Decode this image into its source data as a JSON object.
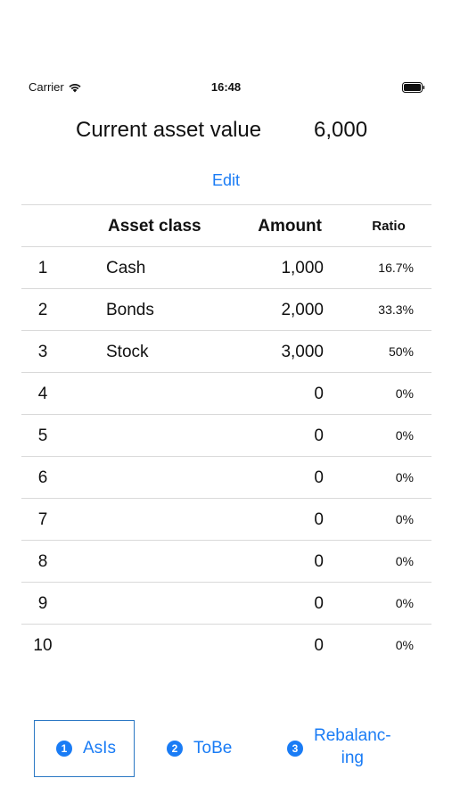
{
  "status_bar": {
    "carrier": "Carrier",
    "time": "16:48"
  },
  "header": {
    "title": "Current asset value",
    "value": "6,000"
  },
  "edit_label": "Edit",
  "table": {
    "columns": [
      "",
      "Asset class",
      "Amount",
      "Ratio"
    ],
    "rows": [
      {
        "no": "1",
        "name": "Cash",
        "amount": "1,000",
        "ratio": "16.7%"
      },
      {
        "no": "2",
        "name": "Bonds",
        "amount": "2,000",
        "ratio": "33.3%"
      },
      {
        "no": "3",
        "name": "Stock",
        "amount": "3,000",
        "ratio": "50%"
      },
      {
        "no": "4",
        "name": "",
        "amount": "0",
        "ratio": "0%"
      },
      {
        "no": "5",
        "name": "",
        "amount": "0",
        "ratio": "0%"
      },
      {
        "no": "6",
        "name": "",
        "amount": "0",
        "ratio": "0%"
      },
      {
        "no": "7",
        "name": "",
        "amount": "0",
        "ratio": "0%"
      },
      {
        "no": "8",
        "name": "",
        "amount": "0",
        "ratio": "0%"
      },
      {
        "no": "9",
        "name": "",
        "amount": "0",
        "ratio": "0%"
      },
      {
        "no": "10",
        "name": "",
        "amount": "0",
        "ratio": "0%"
      }
    ]
  },
  "tabs": [
    {
      "num": "1",
      "label": "AsIs",
      "selected": true
    },
    {
      "num": "2",
      "label": "ToBe",
      "selected": false
    },
    {
      "num": "3",
      "label_line1": "Rebalanc-",
      "label_line2": "ing",
      "selected": false
    }
  ],
  "colors": {
    "accent": "#1a7cf5",
    "selected_border": "#2b78c4",
    "divider": "#d9d9d9"
  },
  "icons": {
    "wifi": "wifi-icon",
    "battery": "battery-icon"
  }
}
